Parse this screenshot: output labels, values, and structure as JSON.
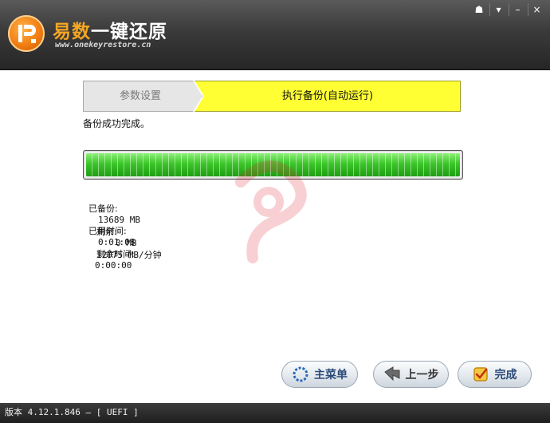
{
  "app": {
    "title_accent": "易数",
    "title_rest": "一键还原",
    "url": "www.onekeyrestore.cn"
  },
  "window_controls": [
    "☗",
    "▾",
    "–",
    "×"
  ],
  "steps": [
    {
      "label": "参数设置",
      "state": "done"
    },
    {
      "label": "执行备份(自动运行)",
      "state": "active"
    }
  ],
  "status": "备份成功完成。",
  "progress": {
    "percent": 100
  },
  "stats": {
    "backed_label": "已备份:",
    "backed_value": "13689 MB",
    "remaining_label": "剩余:",
    "remaining_value": "0 MB",
    "speed": "12075 MB/分钟",
    "elapsed_label": "已用时间:",
    "elapsed_value": "0:01:08",
    "time_left_label": "剩余时间:",
    "time_left_value": "0:00:00"
  },
  "buttons": {
    "main_menu": "主菜单",
    "back": "上一步",
    "finish": "完成"
  },
  "footer": "版本 4.12.1.846 — [ UEFI ]",
  "colors": {
    "accent_orange": "#f5a623",
    "step_active": "#ffff33",
    "progress_green": "#3cc52a",
    "header_dark": "#3a3a3a"
  }
}
